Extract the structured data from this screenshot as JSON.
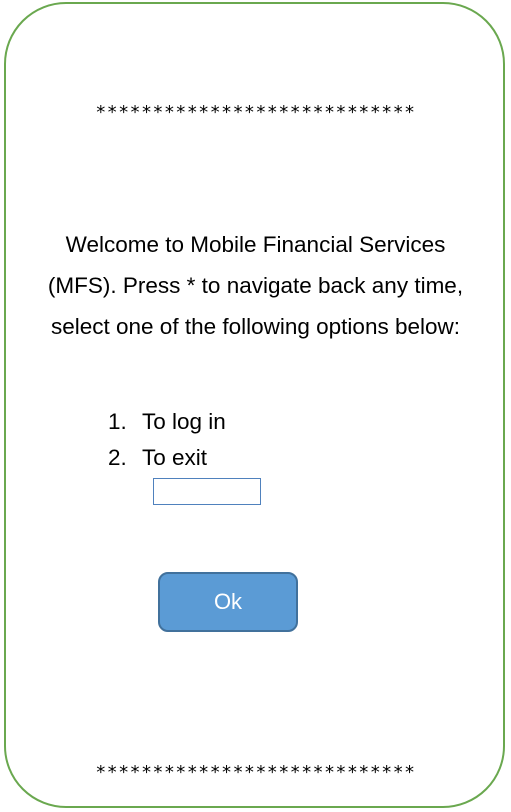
{
  "stars_top": "****************************",
  "welcome_message": "Welcome to Mobile Financial Services (MFS). Press * to navigate back any time, select one of the following options below:",
  "options": [
    {
      "number": "1.",
      "label": "To log in"
    },
    {
      "number": "2.",
      "label": "To exit"
    }
  ],
  "input": {
    "value": "",
    "placeholder": ""
  },
  "ok_button_label": "Ok",
  "stars_bottom": "****************************",
  "colors": {
    "frame_border": "#6aa84f",
    "button_fill": "#5b9bd5",
    "button_border": "#41719c",
    "input_border": "#4f81bd"
  }
}
